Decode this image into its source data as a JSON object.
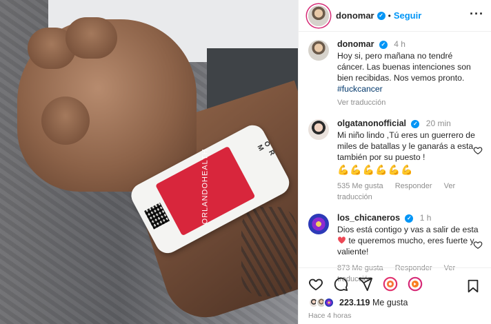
{
  "post_author": {
    "username": "donomar",
    "follow_label": "Seguir",
    "more_label": "···"
  },
  "caption": {
    "username": "donomar",
    "time": "4 h",
    "text": "Hoy si, pero mañana no tendré cáncer. Las buenas intenciones son bien recibidas. Nos vemos pronto.",
    "hashtag": "#fuckcancer",
    "translate_label": "Ver traducción"
  },
  "comments": [
    {
      "username": "olgatanonofficial",
      "time": "20 min",
      "text": "Mi niño lindo ,Tú eres un guerrero de miles de batallas y le ganarás a esta también por su puesto !",
      "emojis": "💪💪💪💪💪💪",
      "likes": "535 Me gusta",
      "reply_label": "Responder",
      "translate_label": "Ver traducción"
    },
    {
      "username": "los_chicaneros",
      "time": "1 h",
      "text_before": "Dios está contigo y vas a salir de esta ",
      "text_after": " te queremos mucho, eres fuerte y valiente!",
      "likes": "873 Me gusta",
      "reply_label": "Responder",
      "translate_label": "Ver traducción"
    }
  ],
  "footer": {
    "likes_count": "223.119",
    "likes_label": "Me gusta",
    "time_ago": "Hace 4 horas"
  },
  "photo": {
    "band_text": "ORLANDOHEALTH",
    "band_side": "O R M"
  },
  "colors": {
    "link_blue": "#0095f6",
    "band_red": "#d8263c",
    "heart_red": "#ed4956"
  },
  "icons": [
    "heart-icon",
    "comment-icon",
    "share-icon",
    "story-icon",
    "bookmark-icon"
  ]
}
